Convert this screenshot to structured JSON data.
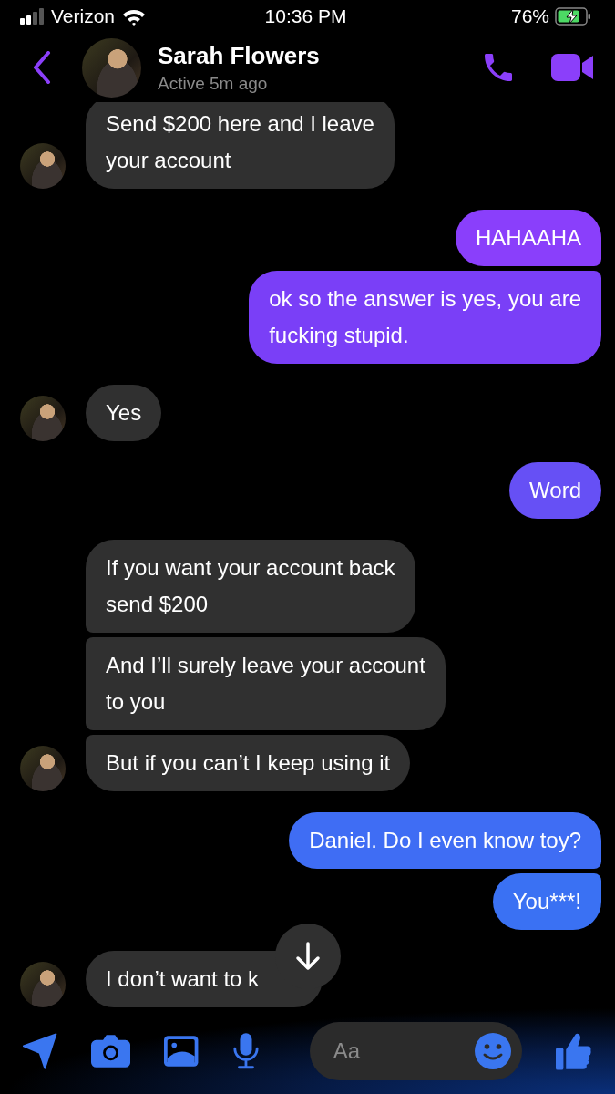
{
  "status_bar": {
    "carrier": "Verizon",
    "time": "10:36 PM",
    "battery": "76%"
  },
  "header": {
    "name": "Sarah Flowers",
    "presence": "Active 5m ago"
  },
  "messages": [
    {
      "kind": "incoming",
      "text": "Send $200 here and I leave\nyour account",
      "avatar": true
    },
    {
      "kind": "outgoing",
      "text": "HAHAAHA",
      "color": "#8a3ffb"
    },
    {
      "kind": "outgoing",
      "text": "ok so the answer is yes, you are\nfucking stupid.",
      "color": "#7a3ff7"
    },
    {
      "kind": "incoming",
      "text": "Yes",
      "avatar": true
    },
    {
      "kind": "outgoing",
      "text": "Word",
      "color": "#6650f5"
    },
    {
      "kind": "incoming",
      "text": "If you want your account back\nsend $200",
      "avatar": false
    },
    {
      "kind": "incoming",
      "text": "And I’ll surely leave your account\nto you",
      "avatar": false
    },
    {
      "kind": "incoming",
      "text": "But if you can’t I keep using it",
      "avatar": true
    },
    {
      "kind": "outgoing",
      "text": "Daniel. Do I even know toy?",
      "color": "#3f6df4"
    },
    {
      "kind": "outgoing",
      "text": "You***!",
      "color": "#3a71f3"
    },
    {
      "kind": "incoming",
      "text": "I don’t want to k",
      "avatar": true
    }
  ],
  "composer": {
    "placeholder": "Aa"
  }
}
